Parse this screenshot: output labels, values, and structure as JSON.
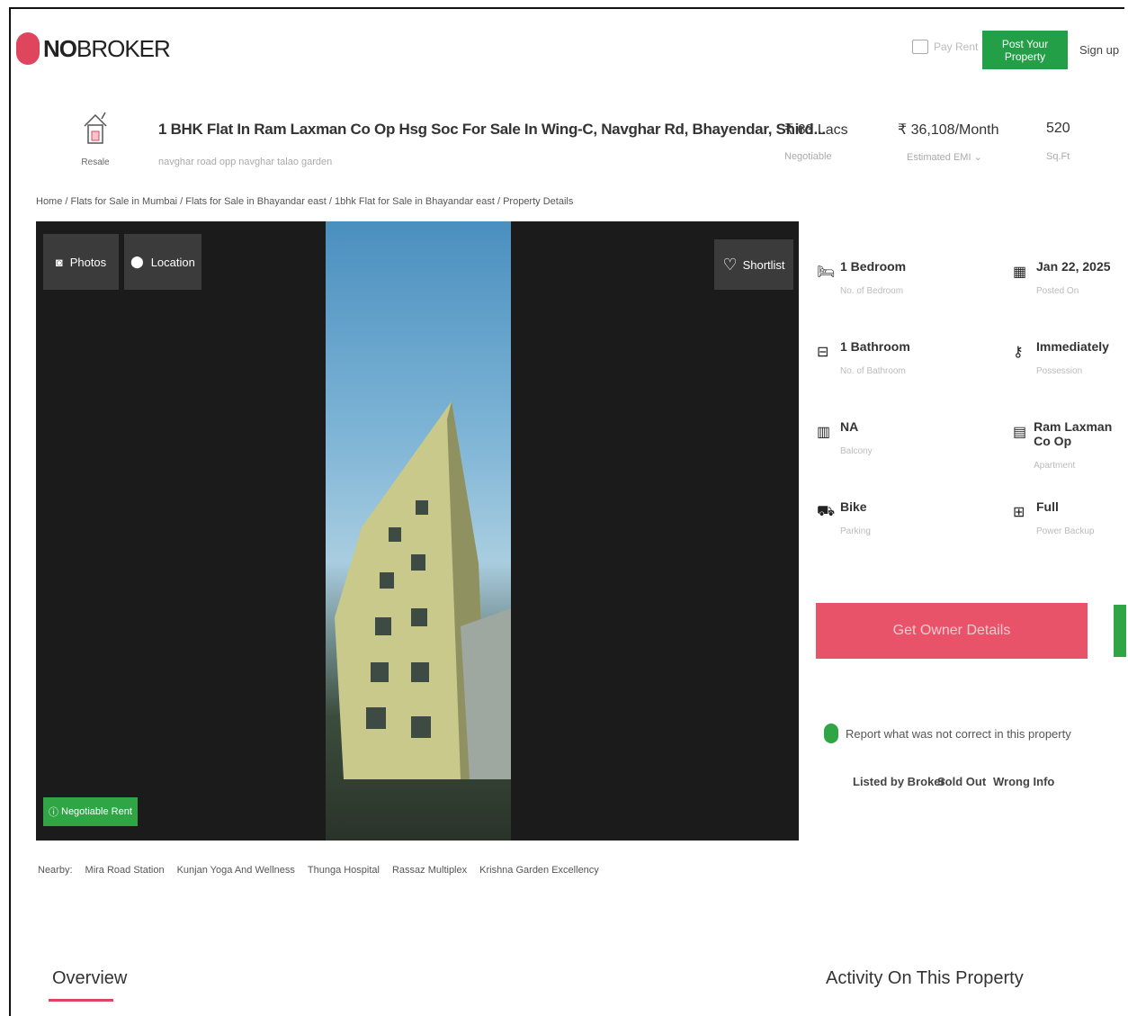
{
  "header": {
    "brand": "NOBROKER",
    "brand_bold": "NO",
    "brand_rest": "BROKER",
    "pay_rent": "Pay Rent",
    "post_property": "Post Your Property",
    "sign_up": "Sign up"
  },
  "listing": {
    "type_label": "Resale",
    "title": "1 BHK Flat In Ram Laxman Co Op Hsg Soc For Sale In Wing-C, Navghar Rd, Bhayendar, Shird...",
    "address": "navghar road opp navghar talao garden",
    "price": "₹ 63 Lacs",
    "price_note": "Negotiable",
    "emi": "₹ 36,108/Month",
    "emi_note": "Estimated EMI ⌄",
    "area": "520",
    "area_unit": "Sq.Ft"
  },
  "breadcrumb": "Home / Flats for Sale in Mumbai / Flats for Sale in Bhayandar east / 1bhk Flat for Sale in Bhayandar east / Property Details",
  "gallery": {
    "photos_label": "Photos",
    "location_label": "Location",
    "shortlist_label": "Shortlist",
    "negotiable_label": "Negotiable Rent"
  },
  "details": [
    {
      "value": "1 Bedroom",
      "label": "No. of Bedroom",
      "icon": "bed-icon"
    },
    {
      "value": "Jan 22, 2025",
      "label": "Posted On",
      "icon": "calendar-icon"
    },
    {
      "value": "1 Bathroom",
      "label": "No. of Bathroom",
      "icon": "bath-icon"
    },
    {
      "value": "Immediately",
      "label": "Possession",
      "icon": "key-icon"
    },
    {
      "value": "NA",
      "label": "Balcony",
      "icon": "balcony-icon"
    },
    {
      "value": "Ram Laxman Co Op",
      "label": "Apartment",
      "icon": "building-icon"
    },
    {
      "value": "Bike",
      "label": "Parking",
      "icon": "car-icon"
    },
    {
      "value": "Full",
      "label": "Power Backup",
      "icon": "battery-icon"
    }
  ],
  "owner_button": "Get Owner Details",
  "report": {
    "text": "Report what was not correct in this property",
    "links": [
      "Listed by Broker",
      "Sold Out",
      "Wrong Info"
    ]
  },
  "nearby": {
    "label": "Nearby:",
    "places": [
      "Mira Road Station",
      "Kunjan Yoga And Wellness",
      "Thunga Hospital",
      "Rassaz Multiplex",
      "Krishna Garden Excellency"
    ]
  },
  "tabs": {
    "overview": "Overview",
    "activity": "Activity On This Property"
  },
  "colors": {
    "brand_red": "#e0455e",
    "green": "#23a047",
    "owner_button": "#e8536a"
  }
}
